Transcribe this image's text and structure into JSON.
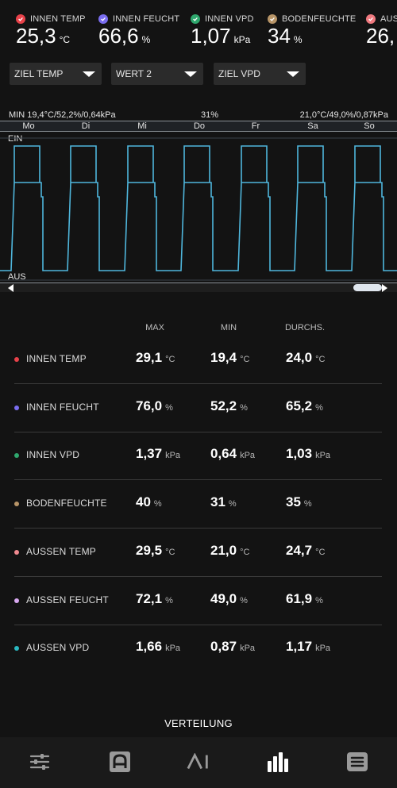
{
  "metrics": [
    {
      "label": "INNEN TEMP",
      "value": "25,3",
      "unit": "°C",
      "color": "#e8424a"
    },
    {
      "label": "INNEN FEUCHT",
      "value": "66,6",
      "unit": "%",
      "color": "#7a6df0"
    },
    {
      "label": "INNEN VPD",
      "value": "1,07",
      "unit": "kPa",
      "color": "#2fa86e"
    },
    {
      "label": "BODENFEUCHTE",
      "value": "34",
      "unit": "%",
      "color": "#b89568"
    },
    {
      "label": "AUS",
      "value": "26,",
      "unit": "",
      "color": "#f07a80"
    }
  ],
  "selectors": [
    {
      "label": "ZIEL TEMP"
    },
    {
      "label": "WERT 2"
    },
    {
      "label": "ZIEL VPD"
    }
  ],
  "chart": {
    "min_text": "MIN 19,4°C/52,2%/0,64kPa",
    "mid_text": "31%",
    "max_text": "21,0°C/49,0%/0,87kPa",
    "days": [
      "Mo",
      "Di",
      "Mi",
      "Do",
      "Fr",
      "Sa",
      "So"
    ],
    "top_label": "EIN",
    "bottom_label": "AUS",
    "line_color": "#4fb6dc"
  },
  "table": {
    "headers": [
      "MAX",
      "MIN",
      "DURCHS."
    ],
    "rows": [
      {
        "name": "INNEN TEMP",
        "color": "#e8424a",
        "max": "29,1",
        "min": "19,4",
        "avg": "24,0",
        "unit": "°C"
      },
      {
        "name": "INNEN FEUCHT",
        "color": "#7a6df0",
        "max": "76,0",
        "min": "52,2",
        "avg": "65,2",
        "unit": "%"
      },
      {
        "name": "INNEN VPD",
        "color": "#2fa86e",
        "max": "1,37",
        "min": "0,64",
        "avg": "1,03",
        "unit": "kPa"
      },
      {
        "name": "BODENFEUCHTE",
        "color": "#b89568",
        "max": "40",
        "min": "31",
        "avg": "35",
        "unit": "%"
      },
      {
        "name": "AUSSEN TEMP",
        "color": "#f08a90",
        "max": "29,5",
        "min": "21,0",
        "avg": "24,7",
        "unit": "°C"
      },
      {
        "name": "AUSSEN FEUCHT",
        "color": "#d8a8f0",
        "max": "72,1",
        "min": "49,0",
        "avg": "61,9",
        "unit": "%"
      },
      {
        "name": "AUSSEN VPD",
        "color": "#2ab8c0",
        "max": "1,66",
        "min": "0,87",
        "avg": "1,17",
        "unit": "kPa"
      }
    ]
  },
  "footer": {
    "title": "VERTEILUNG"
  },
  "nav": [
    {
      "icon": "sliders-icon"
    },
    {
      "icon": "controller-icon"
    },
    {
      "icon": "ai-icon"
    },
    {
      "icon": "bar-chart-icon"
    },
    {
      "icon": "list-icon"
    }
  ]
}
